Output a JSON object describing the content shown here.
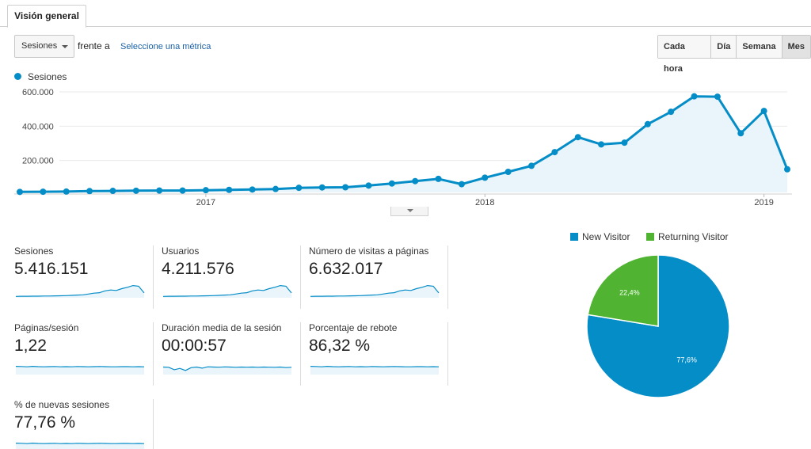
{
  "tab": {
    "label": "Visión general"
  },
  "toolbar": {
    "metric": "Sesiones",
    "versus": "frente a",
    "select_metric": "Seleccione una métrica",
    "granularity": [
      "Cada hora",
      "Día",
      "Semana",
      "Mes"
    ],
    "active_granularity": "Mes"
  },
  "colors": {
    "series": "#058dc7",
    "area": "#e9f4fb",
    "new_visitor": "#058dc7",
    "returning_visitor": "#50b432"
  },
  "chart_data": [
    {
      "type": "area",
      "legend_position": "top-left",
      "series": [
        {
          "name": "Sesiones",
          "values": [
            3000,
            4000,
            5000,
            8000,
            9000,
            10000,
            11000,
            11000,
            13000,
            15000,
            17000,
            20000,
            27000,
            29000,
            30000,
            40000,
            52000,
            66000,
            79000,
            48000,
            86000,
            120000,
            155000,
            235000,
            322000,
            280000,
            290000,
            398000,
            470000,
            560000,
            558000,
            345000,
            475000,
            135000
          ]
        }
      ],
      "yticks": [
        "200.000",
        "400.000",
        "600.000"
      ],
      "ylim": [
        0,
        600000
      ],
      "xticks": [
        "2017",
        "2018",
        "2019"
      ],
      "grid": true
    },
    {
      "type": "pie",
      "legend": [
        "New Visitor",
        "Returning Visitor"
      ],
      "values": [
        77.6,
        22.4
      ],
      "labels": [
        "77,6%",
        "22,4%"
      ],
      "legend_position": "top"
    }
  ],
  "metrics": [
    {
      "label": "Sesiones",
      "value": "5.416.151",
      "trend": "growth"
    },
    {
      "label": "Usuarios",
      "value": "4.211.576",
      "trend": "growth"
    },
    {
      "label": "Número de visitas a páginas",
      "value": "6.632.017",
      "trend": "growth"
    },
    {
      "label": "Páginas/sesión",
      "value": "1,22",
      "trend": "flat"
    },
    {
      "label": "Duración media de la sesión",
      "value": "00:00:57",
      "trend": "flat_dip"
    },
    {
      "label": "Porcentaje de rebote",
      "value": "86,32 %",
      "trend": "flat"
    },
    {
      "label": "% de nuevas sesiones",
      "value": "77,76 %",
      "trend": "flat"
    }
  ]
}
